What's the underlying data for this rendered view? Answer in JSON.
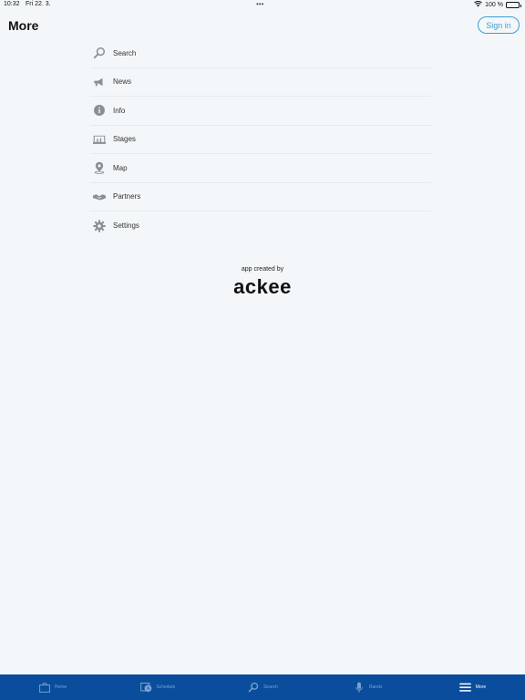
{
  "status_bar": {
    "time": "10:32",
    "date": "Fri 22. 3.",
    "dots": "•••",
    "battery": "100 %"
  },
  "header": {
    "title": "More",
    "sign_in_label": "Sign in"
  },
  "menu": {
    "items": [
      {
        "label": "Search",
        "icon": "search-icon"
      },
      {
        "label": "News",
        "icon": "megaphone-icon"
      },
      {
        "label": "Info",
        "icon": "info-icon"
      },
      {
        "label": "Stages",
        "icon": "stage-icon"
      },
      {
        "label": "Map",
        "icon": "map-pin-icon"
      },
      {
        "label": "Partners",
        "icon": "handshake-icon"
      },
      {
        "label": "Settings",
        "icon": "gear-icon"
      }
    ]
  },
  "branding": {
    "credit": "app created by",
    "company": "ackee"
  },
  "tab_bar": {
    "tabs": [
      {
        "label": "Home",
        "icon": "home-icon",
        "active": false
      },
      {
        "label": "Schedule",
        "icon": "schedule-icon",
        "active": false
      },
      {
        "label": "Search",
        "icon": "search-icon",
        "active": false
      },
      {
        "label": "Bands",
        "icon": "microphone-icon",
        "active": false
      },
      {
        "label": "More",
        "icon": "menu-icon",
        "active": true
      }
    ]
  },
  "colors": {
    "accent": "#3aa0d8",
    "tab_bar_bg": "#0a4d9c",
    "background": "#f4f7f9"
  }
}
